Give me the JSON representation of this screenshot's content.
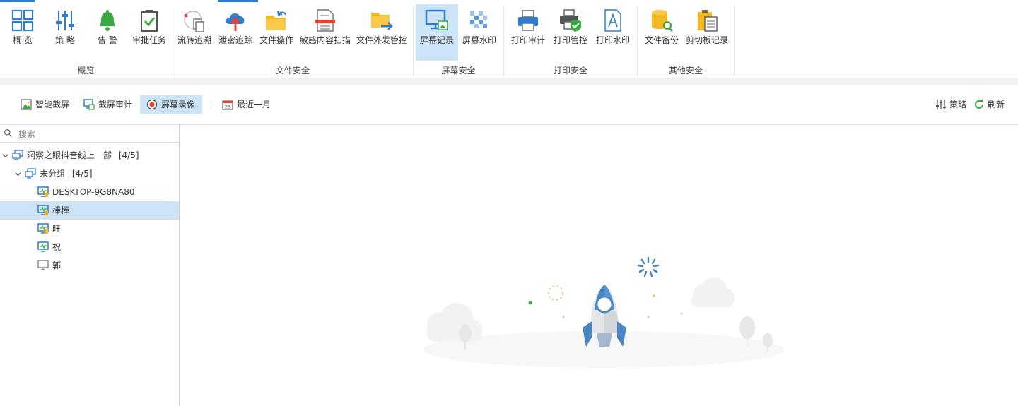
{
  "ribbon": {
    "groups": [
      {
        "label": "概览",
        "buttons": [
          {
            "label": "概 览",
            "icon": "overview-grid-icon"
          },
          {
            "label": "策 略",
            "icon": "policy-sliders-icon"
          },
          {
            "label": "告 警",
            "icon": "alarm-bell-icon"
          },
          {
            "label": "审批任务",
            "icon": "approval-clipboard-icon"
          }
        ]
      },
      {
        "label": "文件安全",
        "buttons": [
          {
            "label": "流转追溯",
            "icon": "file-trace-icon"
          },
          {
            "label": "泄密追踪",
            "icon": "cloud-upload-icon"
          },
          {
            "label": "文件操作",
            "icon": "folder-operation-icon"
          },
          {
            "label": "敏感内容扫描",
            "icon": "document-scan-icon"
          },
          {
            "label": "文件外发管控",
            "icon": "folder-send-icon"
          }
        ]
      },
      {
        "label": "屏幕安全",
        "buttons": [
          {
            "label": "屏幕记录",
            "icon": "monitor-record-icon"
          },
          {
            "label": "屏幕水印",
            "icon": "watermark-checker-icon"
          }
        ]
      },
      {
        "label": "打印安全",
        "buttons": [
          {
            "label": "打印审计",
            "icon": "printer-icon"
          },
          {
            "label": "打印管控",
            "icon": "printer-shield-icon"
          },
          {
            "label": "打印水印",
            "icon": "document-a-icon"
          }
        ]
      },
      {
        "label": "其他安全",
        "buttons": [
          {
            "label": "文件备份",
            "icon": "database-search-icon"
          },
          {
            "label": "剪切板记录",
            "icon": "clipboard-icon"
          }
        ]
      }
    ],
    "active_button": "屏幕记录"
  },
  "toolbar": {
    "smart_capture": "智能截屏",
    "capture_audit": "截屏审计",
    "screen_recording": "屏幕录像",
    "time_range": "最近一月",
    "policy": "策略",
    "refresh": "刷新"
  },
  "sidebar": {
    "search_placeholder": "搜索",
    "tree": {
      "root": {
        "label": "洞察之眼抖音线上一部",
        "count": "[4/5]"
      },
      "group": {
        "label": "未分组",
        "count": "[4/5]"
      },
      "devices": [
        {
          "name": "DESKTOP-9G8NA80",
          "online": true
        },
        {
          "name": "棒棒",
          "online": true,
          "selected": true
        },
        {
          "name": "旺",
          "online": true
        },
        {
          "name": "祝",
          "online": true
        },
        {
          "name": "郭",
          "online": false
        }
      ]
    }
  },
  "colors": {
    "accent": "#2f7dd1",
    "selected_bg": "#cde4f7",
    "online_monitor": "#2d7cc9",
    "offline_monitor": "#8a8a8a",
    "rocket_blue": "#4a86c5"
  }
}
